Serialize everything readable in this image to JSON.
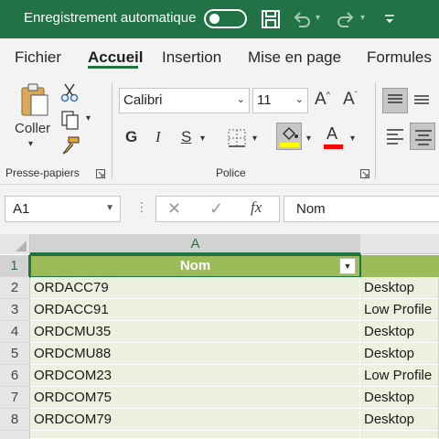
{
  "titlebar": {
    "autosave_label": "Enregistrement automatique",
    "bg_color": "#217346"
  },
  "tabs": [
    {
      "label": "Fichier"
    },
    {
      "label": "Accueil",
      "active": true
    },
    {
      "label": "Insertion"
    },
    {
      "label": "Mise en page"
    },
    {
      "label": "Formules"
    }
  ],
  "ribbon": {
    "clipboard": {
      "paste_label": "Coller",
      "group_label": "Presse-papiers"
    },
    "font": {
      "font_name": "Calibri",
      "font_size": "11",
      "bold": "G",
      "italic": "I",
      "underline": "S",
      "group_label": "Police",
      "fill_color": "#ffff00",
      "font_color": "#ff0000"
    }
  },
  "formula_bar": {
    "name_box": "A1",
    "formula": "Nom"
  },
  "grid": {
    "column_headers": [
      "A"
    ],
    "row_numbers": [
      "1",
      "2",
      "3",
      "4",
      "5",
      "6",
      "7",
      "8"
    ],
    "header_cell": "Nom",
    "rows": [
      {
        "a": "ORDACC79",
        "b": "Desktop"
      },
      {
        "a": "ORDACC91",
        "b": "Low Profile"
      },
      {
        "a": "ORDCMU35",
        "b": "Desktop"
      },
      {
        "a": "ORDCMU88",
        "b": "Desktop"
      },
      {
        "a": "ORDCOM23",
        "b": "Low Profile"
      },
      {
        "a": "ORDCOM75",
        "b": "Desktop"
      },
      {
        "a": "ORDCOM79",
        "b": "Desktop"
      }
    ],
    "header_color": "#9bbb59",
    "band_color": "#ebf1de"
  }
}
